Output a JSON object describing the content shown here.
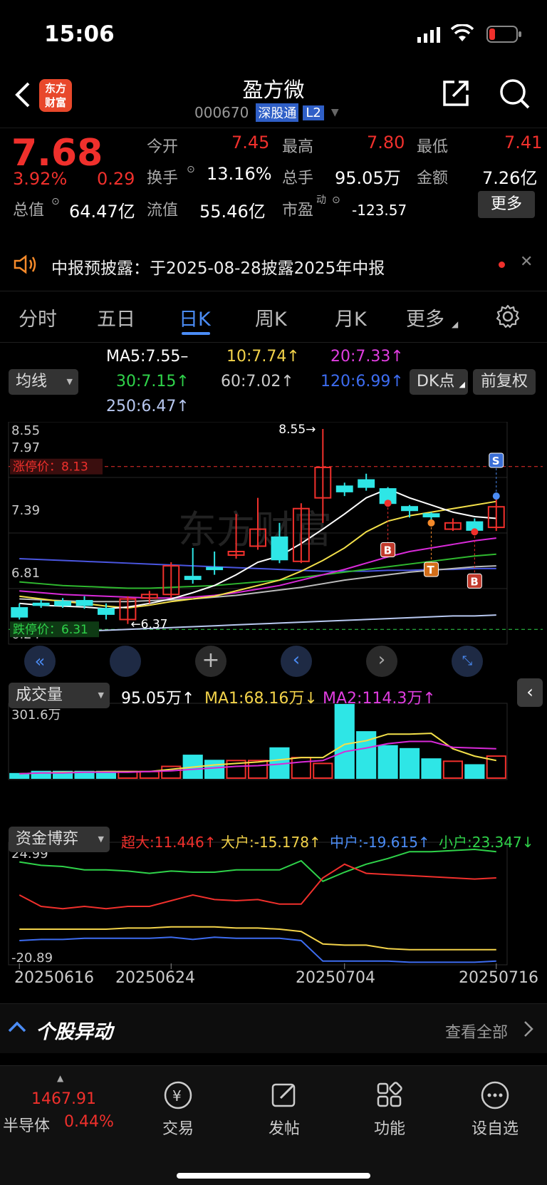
{
  "status": {
    "time": "15:06"
  },
  "header": {
    "title": "盈方微",
    "code": "000670",
    "badge1": "深股通",
    "badge2": "L2",
    "logo_text": "东方\n财富"
  },
  "quote": {
    "price": "7.68",
    "pct": "3.92%",
    "chg": "0.29",
    "open_label": "今开",
    "open": "7.45",
    "high_label": "最高",
    "high": "7.80",
    "low_label": "最低",
    "low": "7.41",
    "turnover_label": "换手",
    "turnover": "13.16%",
    "vol_label": "总手",
    "vol": "95.05万",
    "amt_label": "金额",
    "amt": "7.26亿",
    "mcap_label": "总值",
    "mcap": "64.47亿",
    "float_label": "流值",
    "float": "55.46亿",
    "pe_label": "市盈",
    "pe_sup": "动",
    "pe": "-123.57",
    "more": "更多"
  },
  "notice": {
    "text": "中报预披露：于2025-08-28披露2025年中报"
  },
  "tabs": {
    "items": [
      "分时",
      "五日",
      "日K",
      "周K",
      "月K",
      "更多"
    ],
    "active": 2
  },
  "ma": {
    "selector": "均线",
    "ma5": "MA5:7.55–",
    "ma10": "10:7.74↑",
    "ma20": "20:7.33↑",
    "ma30": "30:7.15↑",
    "ma60": "60:7.02↑",
    "ma120": "120:6.99↑",
    "ma250": "250:6.47↑",
    "dk": "DK点",
    "fq": "前复权"
  },
  "kline": {
    "yticks": [
      "8.55",
      "7.97",
      "7.39",
      "6.81",
      "6.24"
    ],
    "limit_up": "涨停价：8.13",
    "limit_down": "跌停价：6.31",
    "max_label": "8.55→",
    "min_label": "←6.37",
    "watermark": "东方财富",
    "colors": {
      "up": "#f0302c",
      "down": "#2ee6e6",
      "ma5": "#ffffff",
      "ma10": "#f3e04a",
      "ma20": "#d82ad8",
      "ma30": "#2fb82f",
      "ma60": "#bbbbbb",
      "ma120": "#4a56e0",
      "ma250": "#b8c8f0"
    },
    "markers": [
      "B",
      "T",
      "B",
      "S"
    ]
  },
  "volume": {
    "selector": "成交量",
    "vol": "95.05万↑",
    "ma1": "MA1:68.16万↓",
    "ma2": "MA2:114.3万↑",
    "ytop": "301.6万"
  },
  "flow": {
    "selector": "资金博弈",
    "super": "超大:11.446↑",
    "big": "大户:-15.178↑",
    "mid": "中户:-19.615↑",
    "small": "小户:23.347↓",
    "ytop": "24.99",
    "ybot": "-20.89"
  },
  "dates": [
    "20250616",
    "20250624",
    "20250704",
    "20250716"
  ],
  "movers": {
    "title": "个股异动",
    "view_all": "查看全部"
  },
  "nav": {
    "index_val": "1467.91",
    "index_name": "半导体",
    "index_pct": "0.44%",
    "items": [
      "交易",
      "发帖",
      "功能",
      "设自选"
    ]
  },
  "chart_data": {
    "type": "candlestick",
    "ylim": [
      6.24,
      8.55
    ],
    "candles": [
      {
        "o": 6.55,
        "c": 6.45,
        "h": 6.6,
        "l": 6.42
      },
      {
        "o": 6.6,
        "c": 6.58,
        "h": 6.64,
        "l": 6.55
      },
      {
        "o": 6.62,
        "c": 6.58,
        "h": 6.66,
        "l": 6.55
      },
      {
        "o": 6.63,
        "c": 6.58,
        "h": 6.68,
        "l": 6.54
      },
      {
        "o": 6.54,
        "c": 6.48,
        "h": 6.6,
        "l": 6.42
      },
      {
        "o": 6.42,
        "c": 6.65,
        "h": 6.68,
        "l": 6.37
      },
      {
        "o": 6.66,
        "c": 6.7,
        "h": 6.74,
        "l": 6.6
      },
      {
        "o": 6.7,
        "c": 7.02,
        "h": 7.06,
        "l": 6.66
      },
      {
        "o": 6.9,
        "c": 6.87,
        "h": 7.22,
        "l": 6.82
      },
      {
        "o": 7.0,
        "c": 6.98,
        "h": 7.18,
        "l": 6.92
      },
      {
        "o": 7.14,
        "c": 7.18,
        "h": 7.6,
        "l": 7.1
      },
      {
        "o": 7.24,
        "c": 7.43,
        "h": 7.78,
        "l": 7.2
      },
      {
        "o": 7.34,
        "c": 7.09,
        "h": 7.5,
        "l": 7.05
      },
      {
        "o": 7.07,
        "c": 7.66,
        "h": 7.72,
        "l": 7.05
      },
      {
        "o": 7.78,
        "c": 8.12,
        "h": 8.55,
        "l": 7.5
      },
      {
        "o": 7.91,
        "c": 7.85,
        "h": 7.95,
        "l": 7.8
      },
      {
        "o": 7.98,
        "c": 7.9,
        "h": 8.05,
        "l": 7.86
      },
      {
        "o": 7.88,
        "c": 7.72,
        "h": 7.9,
        "l": 7.7
      },
      {
        "o": 7.68,
        "c": 7.64,
        "h": 7.7,
        "l": 7.56
      },
      {
        "o": 7.6,
        "c": 7.57,
        "h": 7.62,
        "l": 7.5
      },
      {
        "o": 7.43,
        "c": 7.5,
        "h": 7.55,
        "l": 7.41
      },
      {
        "o": 7.51,
        "c": 7.42,
        "h": 7.55,
        "l": 7.4
      },
      {
        "o": 7.45,
        "c": 7.68,
        "h": 7.8,
        "l": 7.41
      }
    ],
    "ma5": [
      6.6,
      6.58,
      6.57,
      6.56,
      6.54,
      6.56,
      6.6,
      6.65,
      6.72,
      6.8,
      6.92,
      7.06,
      7.13,
      7.27,
      7.43,
      7.6,
      7.78,
      7.88,
      7.78,
      7.7,
      7.62,
      7.57,
      7.55
    ],
    "ma10": [
      6.68,
      6.65,
      6.62,
      6.6,
      6.57,
      6.55,
      6.58,
      6.62,
      6.65,
      6.68,
      6.74,
      6.8,
      6.86,
      6.96,
      7.08,
      7.22,
      7.4,
      7.52,
      7.58,
      7.62,
      7.66,
      7.7,
      7.74
    ],
    "ma20": [
      6.74,
      6.72,
      6.7,
      6.69,
      6.68,
      6.67,
      6.66,
      6.66,
      6.67,
      6.69,
      6.72,
      6.76,
      6.8,
      6.86,
      6.92,
      6.98,
      7.05,
      7.12,
      7.18,
      7.22,
      7.26,
      7.3,
      7.33
    ],
    "ma30": [
      6.84,
      6.82,
      6.8,
      6.79,
      6.78,
      6.77,
      6.77,
      6.78,
      6.79,
      6.8,
      6.82,
      6.84,
      6.86,
      6.89,
      6.92,
      6.95,
      6.98,
      7.01,
      7.04,
      7.07,
      7.1,
      7.13,
      7.15
    ],
    "ma60": [
      6.65,
      6.64,
      6.63,
      6.62,
      6.62,
      6.62,
      6.63,
      6.64,
      6.65,
      6.67,
      6.69,
      6.72,
      6.75,
      6.78,
      6.82,
      6.86,
      6.89,
      6.92,
      6.95,
      6.97,
      6.99,
      7.01,
      7.02
    ],
    "ma120": [
      7.1,
      7.09,
      7.08,
      7.07,
      7.06,
      7.05,
      7.04,
      7.03,
      7.02,
      7.01,
      7.0,
      6.99,
      6.98,
      6.97,
      6.96,
      6.96,
      6.96,
      6.97,
      6.97,
      6.98,
      6.98,
      6.99,
      6.99
    ],
    "ma250": [
      6.26,
      6.27,
      6.28,
      6.29,
      6.3,
      6.31,
      6.32,
      6.33,
      6.34,
      6.35,
      6.36,
      6.37,
      6.38,
      6.39,
      6.4,
      6.41,
      6.42,
      6.43,
      6.44,
      6.45,
      6.46,
      6.46,
      6.47
    ],
    "volume": [
      0.06,
      0.09,
      0.09,
      0.09,
      0.09,
      0.09,
      0.09,
      0.16,
      0.31,
      0.24,
      0.24,
      0.24,
      0.41,
      0.28,
      0.2,
      1.0,
      0.63,
      0.44,
      0.4,
      0.26,
      0.23,
      0.18,
      0.3
    ],
    "vol_ma1": [
      0.06,
      0.07,
      0.08,
      0.08,
      0.09,
      0.09,
      0.09,
      0.12,
      0.15,
      0.18,
      0.2,
      0.22,
      0.25,
      0.28,
      0.28,
      0.46,
      0.51,
      0.6,
      0.6,
      0.61,
      0.4,
      0.3,
      0.24
    ],
    "vol_ma2": [
      0.06,
      0.07,
      0.07,
      0.08,
      0.08,
      0.08,
      0.09,
      0.1,
      0.12,
      0.14,
      0.16,
      0.17,
      0.19,
      0.22,
      0.24,
      0.36,
      0.41,
      0.47,
      0.5,
      0.5,
      0.42,
      0.41,
      0.4
    ],
    "flow_super": [
      0.6,
      0.5,
      0.48,
      0.5,
      0.48,
      0.5,
      0.5,
      0.55,
      0.6,
      0.56,
      0.55,
      0.56,
      0.52,
      0.52,
      0.75,
      0.87,
      0.79,
      0.78,
      0.77,
      0.76,
      0.75,
      0.74,
      0.75
    ],
    "flow_big": [
      0.3,
      0.3,
      0.3,
      0.3,
      0.3,
      0.31,
      0.31,
      0.32,
      0.32,
      0.32,
      0.31,
      0.31,
      0.3,
      0.28,
      0.17,
      0.16,
      0.16,
      0.13,
      0.12,
      0.12,
      0.12,
      0.12,
      0.12
    ],
    "flow_mid": [
      0.2,
      0.21,
      0.21,
      0.22,
      0.22,
      0.22,
      0.22,
      0.23,
      0.21,
      0.23,
      0.22,
      0.22,
      0.22,
      0.2,
      0.02,
      0.02,
      0.02,
      0.02,
      0.01,
      0.01,
      0.01,
      0.01,
      0.02
    ],
    "flow_small": [
      0.89,
      0.86,
      0.85,
      0.82,
      0.82,
      0.81,
      0.79,
      0.81,
      0.8,
      0.8,
      0.82,
      0.82,
      0.82,
      0.9,
      0.72,
      0.8,
      0.87,
      0.92,
      0.98,
      0.98,
      0.99,
      1.0,
      0.98
    ]
  }
}
